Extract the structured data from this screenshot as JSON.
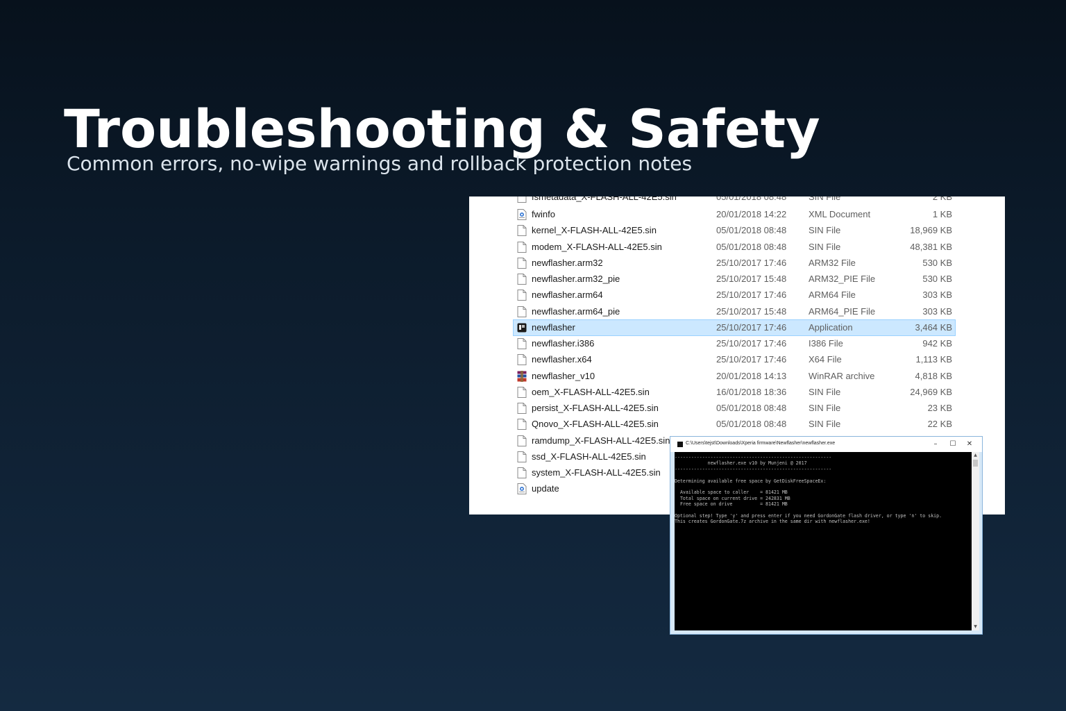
{
  "slide": {
    "title": "Troubleshooting & Safety",
    "subtitle": "Common errors, no-wipe warnings and rollback protection notes"
  },
  "explorer": {
    "partial_row": {
      "name": "fsmetadata_X-FLASH-ALL-42E5.sin",
      "date": "05/01/2018 08:48",
      "type": "SIN File",
      "size": "2 KB"
    },
    "files": [
      {
        "name": "fwinfo",
        "date": "20/01/2018 14:22",
        "type": "XML Document",
        "size": "1 KB",
        "icon": "xml-document-icon",
        "selected": false
      },
      {
        "name": "kernel_X-FLASH-ALL-42E5.sin",
        "date": "05/01/2018 08:48",
        "type": "SIN File",
        "size": "18,969 KB",
        "icon": "file-icon",
        "selected": false
      },
      {
        "name": "modem_X-FLASH-ALL-42E5.sin",
        "date": "05/01/2018 08:48",
        "type": "SIN File",
        "size": "48,381 KB",
        "icon": "file-icon",
        "selected": false
      },
      {
        "name": "newflasher.arm32",
        "date": "25/10/2017 17:46",
        "type": "ARM32 File",
        "size": "530 KB",
        "icon": "file-icon",
        "selected": false
      },
      {
        "name": "newflasher.arm32_pie",
        "date": "25/10/2017 15:48",
        "type": "ARM32_PIE File",
        "size": "530 KB",
        "icon": "file-icon",
        "selected": false
      },
      {
        "name": "newflasher.arm64",
        "date": "25/10/2017 17:46",
        "type": "ARM64 File",
        "size": "303 KB",
        "icon": "file-icon",
        "selected": false
      },
      {
        "name": "newflasher.arm64_pie",
        "date": "25/10/2017 15:48",
        "type": "ARM64_PIE File",
        "size": "303 KB",
        "icon": "file-icon",
        "selected": false
      },
      {
        "name": "newflasher",
        "date": "25/10/2017 17:46",
        "type": "Application",
        "size": "3,464 KB",
        "icon": "application-icon",
        "selected": true
      },
      {
        "name": "newflasher.i386",
        "date": "25/10/2017 17:46",
        "type": "I386 File",
        "size": "942 KB",
        "icon": "file-icon",
        "selected": false
      },
      {
        "name": "newflasher.x64",
        "date": "25/10/2017 17:46",
        "type": "X64 File",
        "size": "1,113 KB",
        "icon": "file-icon",
        "selected": false
      },
      {
        "name": "newflasher_v10",
        "date": "20/01/2018 14:13",
        "type": "WinRAR archive",
        "size": "4,818 KB",
        "icon": "winrar-archive-icon",
        "selected": false
      },
      {
        "name": "oem_X-FLASH-ALL-42E5.sin",
        "date": "16/01/2018 18:36",
        "type": "SIN File",
        "size": "24,969 KB",
        "icon": "file-icon",
        "selected": false
      },
      {
        "name": "persist_X-FLASH-ALL-42E5.sin",
        "date": "05/01/2018 08:48",
        "type": "SIN File",
        "size": "23 KB",
        "icon": "file-icon",
        "selected": false
      },
      {
        "name": "Qnovo_X-FLASH-ALL-42E5.sin",
        "date": "05/01/2018 08:48",
        "type": "SIN File",
        "size": "22 KB",
        "icon": "file-icon",
        "selected": false
      },
      {
        "name": "ramdump_X-FLASH-ALL-42E5.sin",
        "date": "",
        "type": "",
        "size": "",
        "icon": "file-icon",
        "selected": false
      },
      {
        "name": "ssd_X-FLASH-ALL-42E5.sin",
        "date": "",
        "type": "",
        "size": "",
        "icon": "file-icon",
        "selected": false
      },
      {
        "name": "system_X-FLASH-ALL-42E5.sin",
        "date": "",
        "type": "",
        "size": "",
        "icon": "file-icon",
        "selected": false
      },
      {
        "name": "update",
        "date": "",
        "type": "",
        "size": "",
        "icon": "xml-document-icon",
        "selected": false
      }
    ]
  },
  "console": {
    "title": "C:\\Users\\tejst\\Downloads\\Xperia firmware\\Newflasher\\newflasher.exe",
    "minimize_label": "–",
    "maximize_label": "☐",
    "close_label": "✕",
    "output": "---------------------------------------------------------\n            newflasher.exe v10 by Munjeni @ 2017\n---------------------------------------------------------\n\nDetermining available free space by GetDiskFreeSpaceEx:\n\n  Available space to caller    = 81421 MB\n  Total space on current drive = 242831 MB\n  Free space on drive          = 81421 MB\n\nOptional step! Type 'y' and press enter if you need GordonGate flash driver, or type 'n' to skip.\nThis creates GordonGate.7z archive in the same dir with newflasher.exe!"
  },
  "colors": {
    "selection_fill": "#cce8ff",
    "selection_border": "#99d1ff",
    "console_bg": "#000000",
    "console_text": "#c0c0c0"
  }
}
